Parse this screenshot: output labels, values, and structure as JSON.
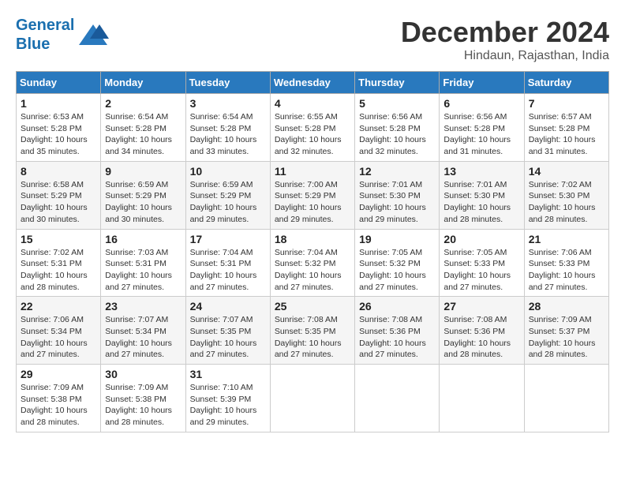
{
  "logo": {
    "line1": "General",
    "line2": "Blue"
  },
  "title": "December 2024",
  "location": "Hindaun, Rajasthan, India",
  "days_of_week": [
    "Sunday",
    "Monday",
    "Tuesday",
    "Wednesday",
    "Thursday",
    "Friday",
    "Saturday"
  ],
  "weeks": [
    [
      {
        "day": "1",
        "sunrise": "Sunrise: 6:53 AM",
        "sunset": "Sunset: 5:28 PM",
        "daylight": "Daylight: 10 hours and 35 minutes."
      },
      {
        "day": "2",
        "sunrise": "Sunrise: 6:54 AM",
        "sunset": "Sunset: 5:28 PM",
        "daylight": "Daylight: 10 hours and 34 minutes."
      },
      {
        "day": "3",
        "sunrise": "Sunrise: 6:54 AM",
        "sunset": "Sunset: 5:28 PM",
        "daylight": "Daylight: 10 hours and 33 minutes."
      },
      {
        "day": "4",
        "sunrise": "Sunrise: 6:55 AM",
        "sunset": "Sunset: 5:28 PM",
        "daylight": "Daylight: 10 hours and 32 minutes."
      },
      {
        "day": "5",
        "sunrise": "Sunrise: 6:56 AM",
        "sunset": "Sunset: 5:28 PM",
        "daylight": "Daylight: 10 hours and 32 minutes."
      },
      {
        "day": "6",
        "sunrise": "Sunrise: 6:56 AM",
        "sunset": "Sunset: 5:28 PM",
        "daylight": "Daylight: 10 hours and 31 minutes."
      },
      {
        "day": "7",
        "sunrise": "Sunrise: 6:57 AM",
        "sunset": "Sunset: 5:28 PM",
        "daylight": "Daylight: 10 hours and 31 minutes."
      }
    ],
    [
      {
        "day": "8",
        "sunrise": "Sunrise: 6:58 AM",
        "sunset": "Sunset: 5:29 PM",
        "daylight": "Daylight: 10 hours and 30 minutes."
      },
      {
        "day": "9",
        "sunrise": "Sunrise: 6:59 AM",
        "sunset": "Sunset: 5:29 PM",
        "daylight": "Daylight: 10 hours and 30 minutes."
      },
      {
        "day": "10",
        "sunrise": "Sunrise: 6:59 AM",
        "sunset": "Sunset: 5:29 PM",
        "daylight": "Daylight: 10 hours and 29 minutes."
      },
      {
        "day": "11",
        "sunrise": "Sunrise: 7:00 AM",
        "sunset": "Sunset: 5:29 PM",
        "daylight": "Daylight: 10 hours and 29 minutes."
      },
      {
        "day": "12",
        "sunrise": "Sunrise: 7:01 AM",
        "sunset": "Sunset: 5:30 PM",
        "daylight": "Daylight: 10 hours and 29 minutes."
      },
      {
        "day": "13",
        "sunrise": "Sunrise: 7:01 AM",
        "sunset": "Sunset: 5:30 PM",
        "daylight": "Daylight: 10 hours and 28 minutes."
      },
      {
        "day": "14",
        "sunrise": "Sunrise: 7:02 AM",
        "sunset": "Sunset: 5:30 PM",
        "daylight": "Daylight: 10 hours and 28 minutes."
      }
    ],
    [
      {
        "day": "15",
        "sunrise": "Sunrise: 7:02 AM",
        "sunset": "Sunset: 5:31 PM",
        "daylight": "Daylight: 10 hours and 28 minutes."
      },
      {
        "day": "16",
        "sunrise": "Sunrise: 7:03 AM",
        "sunset": "Sunset: 5:31 PM",
        "daylight": "Daylight: 10 hours and 27 minutes."
      },
      {
        "day": "17",
        "sunrise": "Sunrise: 7:04 AM",
        "sunset": "Sunset: 5:31 PM",
        "daylight": "Daylight: 10 hours and 27 minutes."
      },
      {
        "day": "18",
        "sunrise": "Sunrise: 7:04 AM",
        "sunset": "Sunset: 5:32 PM",
        "daylight": "Daylight: 10 hours and 27 minutes."
      },
      {
        "day": "19",
        "sunrise": "Sunrise: 7:05 AM",
        "sunset": "Sunset: 5:32 PM",
        "daylight": "Daylight: 10 hours and 27 minutes."
      },
      {
        "day": "20",
        "sunrise": "Sunrise: 7:05 AM",
        "sunset": "Sunset: 5:33 PM",
        "daylight": "Daylight: 10 hours and 27 minutes."
      },
      {
        "day": "21",
        "sunrise": "Sunrise: 7:06 AM",
        "sunset": "Sunset: 5:33 PM",
        "daylight": "Daylight: 10 hours and 27 minutes."
      }
    ],
    [
      {
        "day": "22",
        "sunrise": "Sunrise: 7:06 AM",
        "sunset": "Sunset: 5:34 PM",
        "daylight": "Daylight: 10 hours and 27 minutes."
      },
      {
        "day": "23",
        "sunrise": "Sunrise: 7:07 AM",
        "sunset": "Sunset: 5:34 PM",
        "daylight": "Daylight: 10 hours and 27 minutes."
      },
      {
        "day": "24",
        "sunrise": "Sunrise: 7:07 AM",
        "sunset": "Sunset: 5:35 PM",
        "daylight": "Daylight: 10 hours and 27 minutes."
      },
      {
        "day": "25",
        "sunrise": "Sunrise: 7:08 AM",
        "sunset": "Sunset: 5:35 PM",
        "daylight": "Daylight: 10 hours and 27 minutes."
      },
      {
        "day": "26",
        "sunrise": "Sunrise: 7:08 AM",
        "sunset": "Sunset: 5:36 PM",
        "daylight": "Daylight: 10 hours and 27 minutes."
      },
      {
        "day": "27",
        "sunrise": "Sunrise: 7:08 AM",
        "sunset": "Sunset: 5:36 PM",
        "daylight": "Daylight: 10 hours and 28 minutes."
      },
      {
        "day": "28",
        "sunrise": "Sunrise: 7:09 AM",
        "sunset": "Sunset: 5:37 PM",
        "daylight": "Daylight: 10 hours and 28 minutes."
      }
    ],
    [
      {
        "day": "29",
        "sunrise": "Sunrise: 7:09 AM",
        "sunset": "Sunset: 5:38 PM",
        "daylight": "Daylight: 10 hours and 28 minutes."
      },
      {
        "day": "30",
        "sunrise": "Sunrise: 7:09 AM",
        "sunset": "Sunset: 5:38 PM",
        "daylight": "Daylight: 10 hours and 28 minutes."
      },
      {
        "day": "31",
        "sunrise": "Sunrise: 7:10 AM",
        "sunset": "Sunset: 5:39 PM",
        "daylight": "Daylight: 10 hours and 29 minutes."
      },
      null,
      null,
      null,
      null
    ]
  ]
}
